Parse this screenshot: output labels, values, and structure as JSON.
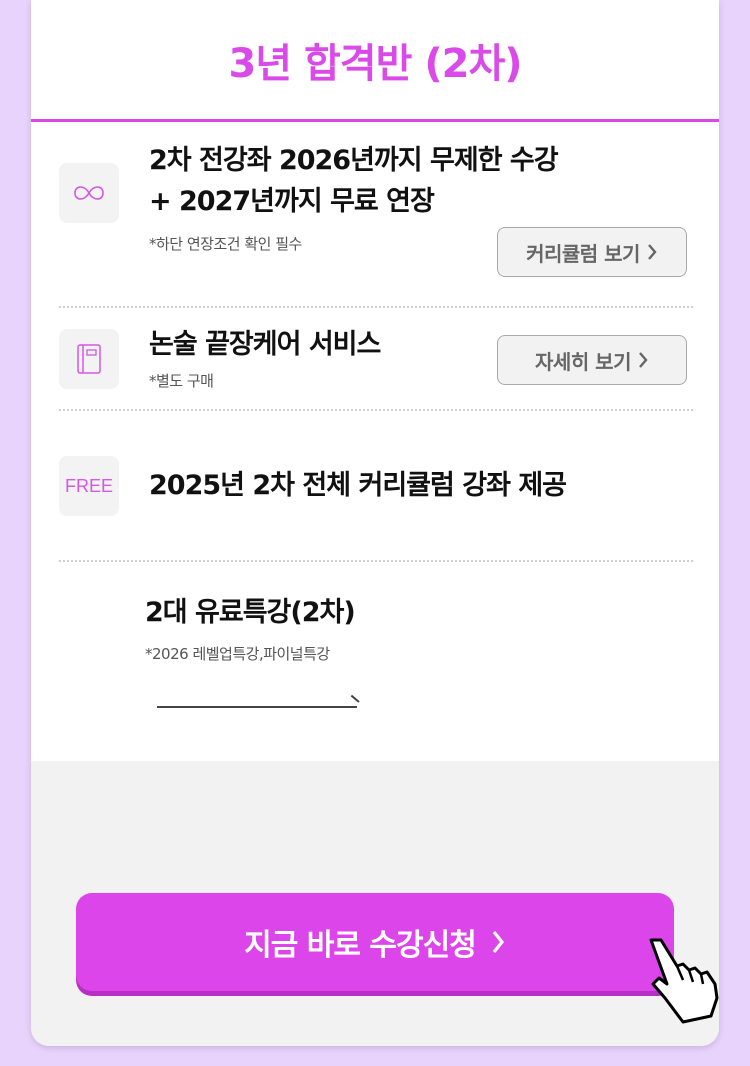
{
  "header": {
    "title": "3년 합격반 (2차)"
  },
  "rows": [
    {
      "icon": "infinity-icon",
      "title_line1": "2차 전강좌 2026년까지 무제한 수강",
      "title_line2": "+ 2027년까지 무료 연장",
      "note": "*하단 연장조건 확인 필수",
      "button": "커리큘럼 보기"
    },
    {
      "icon": "book-icon",
      "title": "논술 끝장케어 서비스",
      "note": "*별도 구매",
      "button": "자세히 보기"
    },
    {
      "icon_text": "FREE",
      "title": "2025년 2차 전체 커리큘럼 강좌 제공"
    },
    {
      "title": "2대 유료특강(2차)",
      "note": "*2026 레벨업특강,파이널특강"
    }
  ],
  "cta": {
    "label": "지금 바로 수강신청"
  },
  "colors": {
    "accent": "#dc45ea",
    "page_bg": "#e7d3fb",
    "section_bg": "#f2f2f2"
  }
}
